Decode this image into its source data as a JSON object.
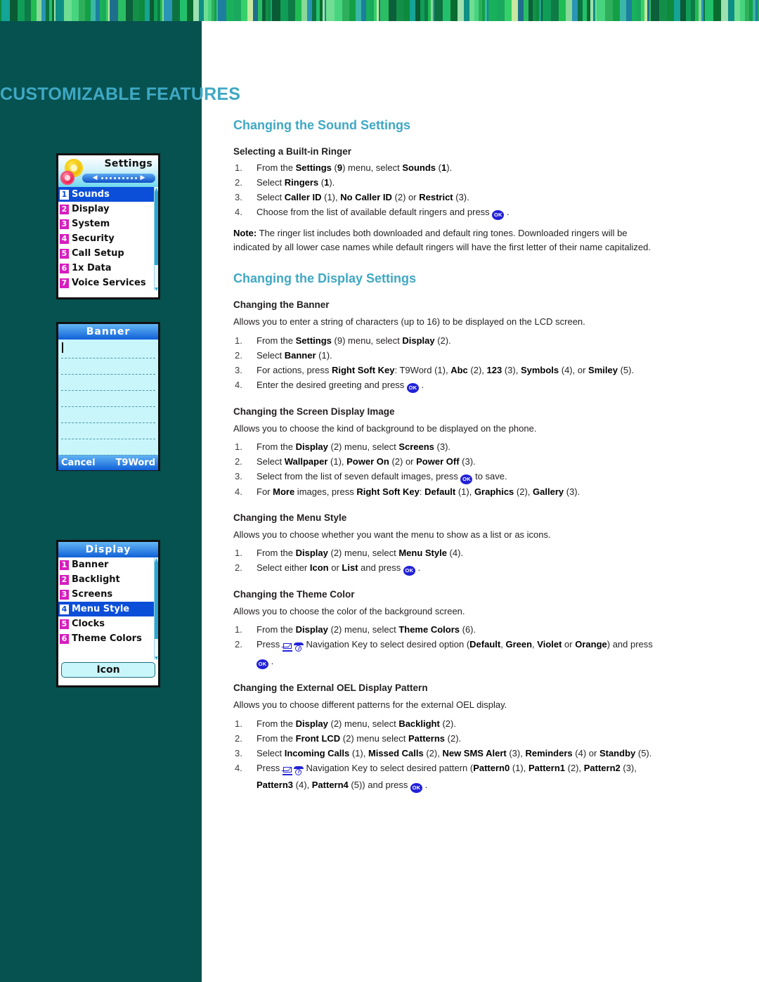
{
  "decor": {
    "band_name": "green-stripe-band",
    "sidebar_color": "#065250",
    "heading_color": "#3fa8c4"
  },
  "page": {
    "title": "CUSTOMIZABLE FEATURES"
  },
  "sections": [
    {
      "heading": "Changing the Sound Settings",
      "subsections": [
        {
          "heading": "Selecting a Built-in Ringer",
          "intro": "",
          "steps": [
            {
              "num": "1.",
              "html": "From the <b>Settings</b> (<b>9</b>) menu, select <b>Sounds</b> (<b>1</b>)."
            },
            {
              "num": "2.",
              "html": "Select <b>Ringers</b> (<b>1</b>)."
            },
            {
              "num": "3.",
              "html": "Select <b>Caller ID</b> (1), <b>No Caller ID</b> (2) or <b>Restrict</b> (3)."
            },
            {
              "num": "4.",
              "html": "Choose from the list of available default ringers and press <span class=\"okkey\">OK</span> ."
            }
          ],
          "note": "<b>Note:</b> The ringer list includes both downloaded and default ring tones. Downloaded ringers will be indicated by all lower case names while default ringers will have the first letter of their name capitalized."
        }
      ]
    },
    {
      "heading": "Changing the Display Settings",
      "subsections": [
        {
          "heading": "Changing the Banner",
          "intro": "Allows you to enter a string of characters (up to 16) to be displayed on the LCD screen.",
          "steps": [
            {
              "num": "1.",
              "html": "From the <b>Settings</b> (9) menu, select <b>Display</b> (2)."
            },
            {
              "num": "2.",
              "html": "Select <b>Banner</b> (1)."
            },
            {
              "num": "3.",
              "html": "For actions, press <b>Right Soft Key</b>: T9Word (1), <b>Abc</b> (2), <b>123</b> (3), <b>Symbols</b> (4), or <b>Smiley</b> (5)."
            },
            {
              "num": "4.",
              "html": "Enter the desired greeting and press <span class=\"okkey\">OK</span> ."
            }
          ],
          "note": ""
        },
        {
          "heading": "Changing the Screen Display Image",
          "intro": "Allows you to choose the kind of background to be displayed on the phone.",
          "steps": [
            {
              "num": "1.",
              "html": "From the <b>Display</b> (2) menu, select <b>Screens</b> (3)."
            },
            {
              "num": "2.",
              "html": "Select <b>Wallpaper</b> (1), <b>Power On</b> (2) or <b>Power Off</b> (3)."
            },
            {
              "num": "3.",
              "html": "Select from the list of seven default images, press <span class=\"okkey\">OK</span> to save."
            },
            {
              "num": "4.",
              "html": "For <b>More</b> images, press <b>Right Soft Key</b>: <b>Default</b> (1), <b>Graphics</b> (2), <b>Gallery</b> (3)."
            }
          ],
          "note": ""
        },
        {
          "heading": "Changing the Menu Style",
          "intro": "Allows you to choose whether you want the menu to show as a list or as icons.",
          "steps": [
            {
              "num": "1.",
              "html": "From the <b>Display</b> (2) menu, select <b>Menu Style</b> (4)."
            },
            {
              "num": "2.",
              "html": "Select either <b>Icon</b> or <b>List</b> and press <span class=\"okkey\">OK</span> ."
            }
          ],
          "note": ""
        },
        {
          "heading": "Changing the Theme Color",
          "intro": "Allows you to choose the color of the background screen.",
          "steps": [
            {
              "num": "1.",
              "html": "From the <b>Display</b> (2) menu, select <b>Theme Colors</b> (6)."
            },
            {
              "num": "2.",
              "html": "Press <span class=\"navkeys\"><span class=\"navkey-env\"><span class=\"env\"></span><span class=\"bar\"></span></span><span class=\"navkey-dial\"><span class=\"arc\"></span><span class=\"circ\"></span><span class=\"hand\"></span></span></span> Navigation Key to select desired option (<b>Default</b>, <b>Green</b>, <b>Violet</b> or <b>Orange</b>) and press <span class=\"okkey\">OK</span> ."
            }
          ],
          "note": ""
        },
        {
          "heading": "Changing the External OEL Display Pattern",
          "intro": "Allows you to choose different patterns for the external OEL display.",
          "steps": [
            {
              "num": "1.",
              "html": "From the <b>Display</b> (2) menu, select <b>Backlight</b> (2)."
            },
            {
              "num": "2.",
              "html": "From the <b>Front LCD</b> (2) menu select <b>Patterns</b> (2)."
            },
            {
              "num": "3.",
              "html": "Select <b>Incoming Calls</b> (1), <b>Missed Calls</b> (2), <b>New SMS Alert</b> (3), <b>Reminders</b> (4) or <b>Standby</b> (5)."
            },
            {
              "num": "4.",
              "html": "Press <span class=\"navkeys\"><span class=\"navkey-env\"><span class=\"env\"></span><span class=\"bar\"></span></span><span class=\"navkey-dial\"><span class=\"arc\"></span><span class=\"circ\"></span><span class=\"hand\"></span></span></span> Navigation Key to select desired pattern (<b>Pattern0</b> (1), <b>Pattern1</b> (2), <b>Pattern2</b> (3), <b>Pattern3</b> (4), <b>Pattern4</b> (5)) and press <span class=\"okkey\">OK</span> ."
            }
          ],
          "note": ""
        }
      ]
    }
  ],
  "phone_screens": {
    "settings": {
      "title": "Settings",
      "icon": "gears-icon",
      "items": [
        {
          "num": "1",
          "label": "Sounds",
          "selected": true
        },
        {
          "num": "2",
          "label": "Display",
          "selected": false
        },
        {
          "num": "3",
          "label": "System",
          "selected": false
        },
        {
          "num": "4",
          "label": "Security",
          "selected": false
        },
        {
          "num": "5",
          "label": "Call Setup",
          "selected": false
        },
        {
          "num": "6",
          "label": "1x Data",
          "selected": false
        },
        {
          "num": "7",
          "label": "Voice Services",
          "selected": false
        }
      ]
    },
    "banner": {
      "title": "Banner",
      "text_value": "",
      "left_softkey": "Cancel",
      "right_softkey": "T9Word"
    },
    "display": {
      "title": "Display",
      "items": [
        {
          "num": "1",
          "label": "Banner",
          "selected": false
        },
        {
          "num": "2",
          "label": "Backlight",
          "selected": false
        },
        {
          "num": "3",
          "label": "Screens",
          "selected": false
        },
        {
          "num": "4",
          "label": "Menu Style",
          "selected": true
        },
        {
          "num": "5",
          "label": "Clocks",
          "selected": false
        },
        {
          "num": "6",
          "label": "Theme Colors",
          "selected": false
        }
      ],
      "softkey": "Icon"
    }
  }
}
